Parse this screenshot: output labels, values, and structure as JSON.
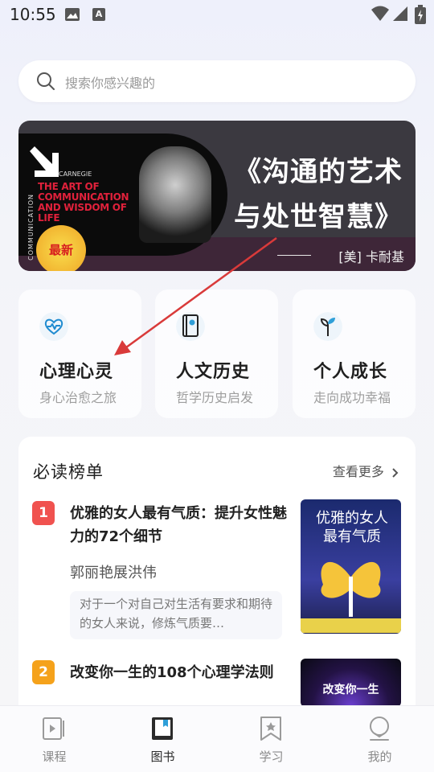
{
  "status_bar": {
    "time": "10:55"
  },
  "search": {
    "placeholder": "搜索你感兴趣的"
  },
  "banner": {
    "title_line1": "《沟通的艺术",
    "title_line2": "与处世智慧》",
    "author": "[美]  卡耐基",
    "book_cover_title": "THE ART OF COMMUNICATION AND WISDOM OF LIFE",
    "book_seal": "最新",
    "book_vertical": "COMMUNICATION"
  },
  "categories": [
    {
      "title": "心理心灵",
      "subtitle": "身心治愈之旅",
      "icon": "heart-pulse-icon",
      "color": "#2f9fd8"
    },
    {
      "title": "人文历史",
      "subtitle": "哲学历史启发",
      "icon": "book-icon",
      "color": "#2f9fd8"
    },
    {
      "title": "个人成长",
      "subtitle": "走向成功幸福",
      "icon": "sprout-icon",
      "color": "#2f9fd8"
    }
  ],
  "ranking": {
    "heading": "必读榜单",
    "more": "查看更多",
    "books": [
      {
        "rank": "1",
        "title": "优雅的女人最有气质：提升女性魅力的72个细节",
        "author": "郭丽艳展洪伟",
        "desc": "对于一个对自己对生活有要求和期待的女人来说，修炼气质要…",
        "cover_text": "优雅的女人最有气质",
        "rank_color": "#f0524f"
      },
      {
        "rank": "2",
        "title": "改变你一生的108个心理学法则",
        "cover_text": "改变你一生",
        "rank_color": "#f5a21b"
      }
    ]
  },
  "tabs": [
    {
      "label": "课程",
      "icon": "course-icon"
    },
    {
      "label": "图书",
      "icon": "book-tab-icon",
      "active": true
    },
    {
      "label": "学习",
      "icon": "bookmark-icon"
    },
    {
      "label": "我的",
      "icon": "profile-icon"
    }
  ]
}
